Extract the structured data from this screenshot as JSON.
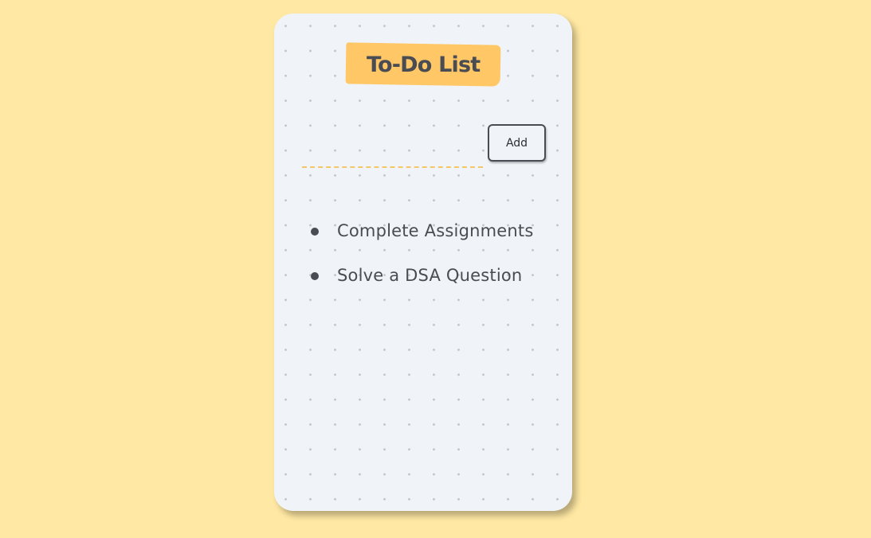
{
  "card": {
    "title": "To-Do List"
  },
  "task_input": {
    "value": "",
    "placeholder": ""
  },
  "add_button": {
    "label": "Add"
  },
  "tasks": [
    {
      "text": "Complete Assignments"
    },
    {
      "text": "Solve a DSA Question"
    }
  ],
  "colors": {
    "page_background": "#ffe8a3",
    "card_background": "#f0f4f8",
    "title_tag": "#ffc766",
    "text": "#494d53",
    "input_underline": "#f4c766"
  }
}
